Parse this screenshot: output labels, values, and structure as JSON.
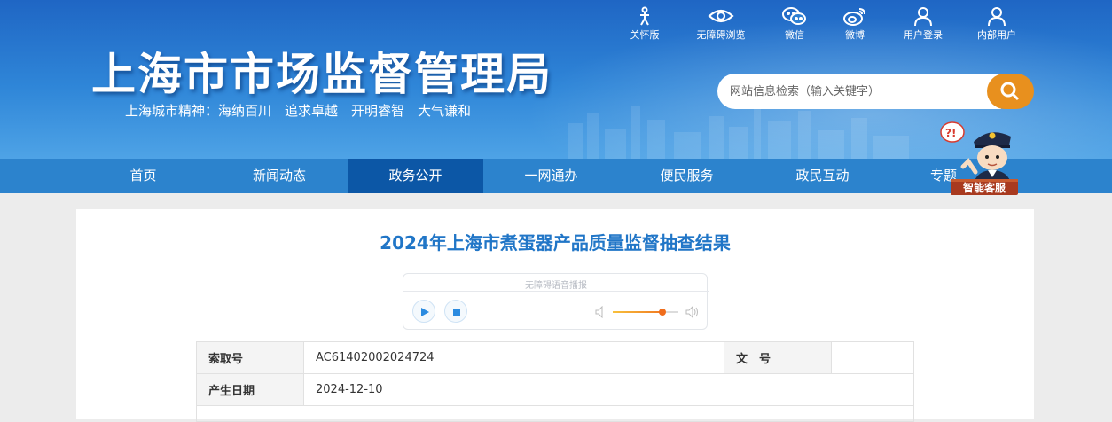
{
  "header": {
    "site_title": "上海市市场监督管理局",
    "motto": "上海城市精神：海纳百川　追求卓越　开明睿智　大气谦和"
  },
  "toolbar": {
    "items": [
      {
        "label": "关怀版",
        "icon": "care-icon"
      },
      {
        "label": "无障碍浏览",
        "icon": "eye-icon"
      },
      {
        "label": "微信",
        "icon": "wechat-icon"
      },
      {
        "label": "微博",
        "icon": "weibo-icon"
      },
      {
        "label": "用户登录",
        "icon": "user-icon"
      },
      {
        "label": "内部用户",
        "icon": "user-icon"
      }
    ]
  },
  "search": {
    "placeholder": "网站信息检索（输入关键字）"
  },
  "nav": {
    "items": [
      {
        "label": "首页"
      },
      {
        "label": "新闻动态"
      },
      {
        "label": "政务公开",
        "active": true
      },
      {
        "label": "一网通办"
      },
      {
        "label": "便民服务"
      },
      {
        "label": "政民互动"
      },
      {
        "label": "专题"
      }
    ]
  },
  "mascot": {
    "badge": "智能客服",
    "bubble": "?!"
  },
  "article": {
    "title": "2024年上海市煮蛋器产品质量监督抽查结果"
  },
  "player": {
    "caption": "无障碍语音播报",
    "volume_fraction": 0.75
  },
  "meta": {
    "index_label": "索取号",
    "index_value": "AC61402002024724",
    "docno_label": "文　号",
    "docno_value": "",
    "date_label": "产生日期",
    "date_value": "2024-12-10"
  },
  "colors": {
    "header_blue": "#2f86d8",
    "nav_blue": "#2c83cd",
    "nav_active": "#0c57a6",
    "title_blue": "#2176c7",
    "search_orange": "#e8901e"
  }
}
